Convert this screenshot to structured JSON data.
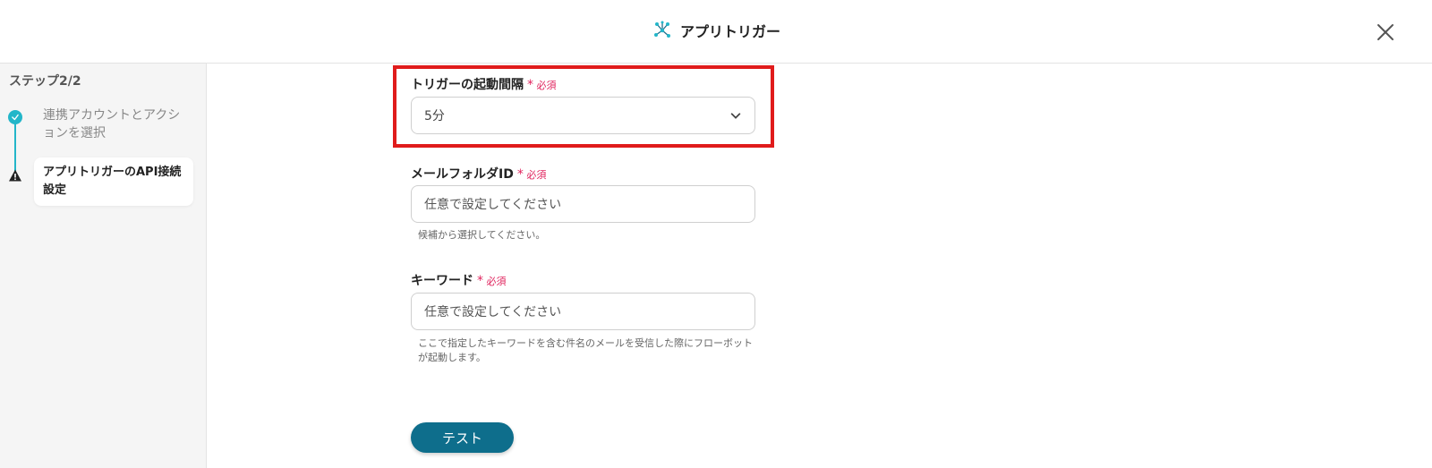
{
  "header": {
    "title": "アプリトリガー"
  },
  "sidebar": {
    "step_label": "ステップ2/2",
    "steps": [
      {
        "label": "連携アカウントとアクションを選択",
        "status": "done"
      },
      {
        "label": "アプリトリガーのAPI接続設定",
        "status": "warning"
      }
    ]
  },
  "form": {
    "interval": {
      "label": "トリガーの起動間隔",
      "required": "必須",
      "value": "5分"
    },
    "folder": {
      "label": "メールフォルダID",
      "required": "必須",
      "placeholder": "任意で設定してください",
      "hint": "候補から選択してください。"
    },
    "keyword": {
      "label": "キーワード",
      "required": "必須",
      "placeholder": "任意で設定してください",
      "hint": "ここで指定したキーワードを含む件名のメールを受信した際にフローボットが起動します。"
    },
    "test_label": "テスト"
  },
  "colors": {
    "accent": "#23b6c9",
    "primary_button": "#0e6e8c",
    "required": "#e0245e",
    "highlight": "#e01b1b"
  }
}
